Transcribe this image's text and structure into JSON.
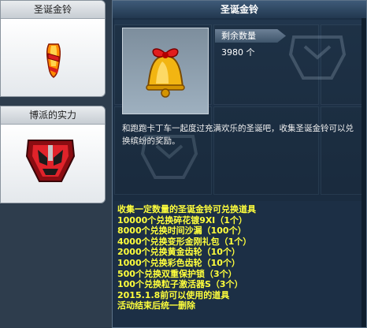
{
  "left_cards": [
    {
      "title": "圣诞金铃",
      "icon": "golden-bell-icon"
    },
    {
      "title": "博派的实力",
      "icon": "autobot-emblem-icon"
    }
  ],
  "panel": {
    "title": "圣诞金铃",
    "count_label": "剩余数量",
    "count_value": "3980 个",
    "description": "和跑跑卡丁车一起度过充满欢乐的圣诞吧，收集圣诞金铃可以兑换缤纷的奖励。",
    "rules": [
      "收集一定数量的圣诞金铃可兑换道具",
      "10000个兑换碎花镀9Ⅺ（1个）",
      "8000个兑换时间沙漏（100个）",
      "4000个兑换变形金刚礼包（1个）",
      "2000个兑换黄金齿轮（10个）",
      "1000个兑换彩色齿轮（10个）",
      "500个兑换双重保护锁（3个）",
      "100个兑换粒子激活器S（3个）",
      "2015.1.8前可以使用的道具",
      "活动结束后统一删除"
    ]
  },
  "colors": {
    "rules_text": "#ffff3c",
    "panel_bg": "#1c2f45"
  }
}
